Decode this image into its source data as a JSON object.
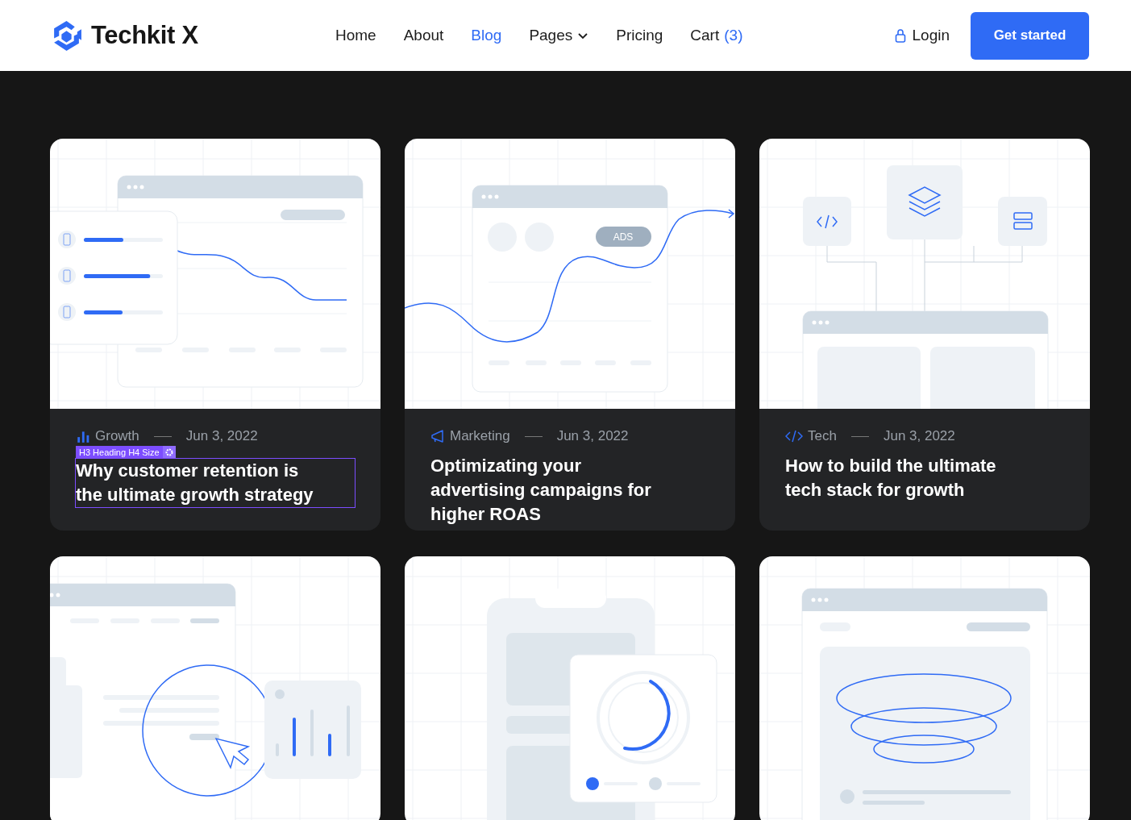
{
  "brand": {
    "name": "Techkit X"
  },
  "nav": [
    {
      "label": "Home",
      "selected": false
    },
    {
      "label": "About",
      "selected": false
    },
    {
      "label": "Blog",
      "selected": true
    },
    {
      "label": "Pages",
      "selected": false,
      "dropdown": true
    },
    {
      "label": "Pricing",
      "selected": false
    },
    {
      "label": "Cart",
      "selected": false,
      "count": "(3)"
    }
  ],
  "login": {
    "label": "Login"
  },
  "cta": {
    "label": "Get started"
  },
  "posts": [
    {
      "kind": "devices",
      "category": {
        "label": "Growth",
        "kind": "bars"
      },
      "date": "Jun 3, 2022",
      "title": "Why customer retention is the ultimate growth strategy",
      "selected": true,
      "editor_badge": "H3 Heading H4 Size"
    },
    {
      "kind": "ads",
      "ads_label": "ADS",
      "category": {
        "label": "Marketing",
        "kind": "megaphone"
      },
      "date": "Jun 3, 2022",
      "title": "Optimizating your advertising campaigns for higher ROAS",
      "selected": false
    },
    {
      "kind": "stack",
      "category": {
        "label": "Tech",
        "kind": "code"
      },
      "date": "Jun 3, 2022",
      "title": "How to build the ultimate tech stack for growth",
      "selected": false
    },
    {
      "kind": "cursor"
    },
    {
      "kind": "phone"
    },
    {
      "kind": "funnel"
    }
  ]
}
